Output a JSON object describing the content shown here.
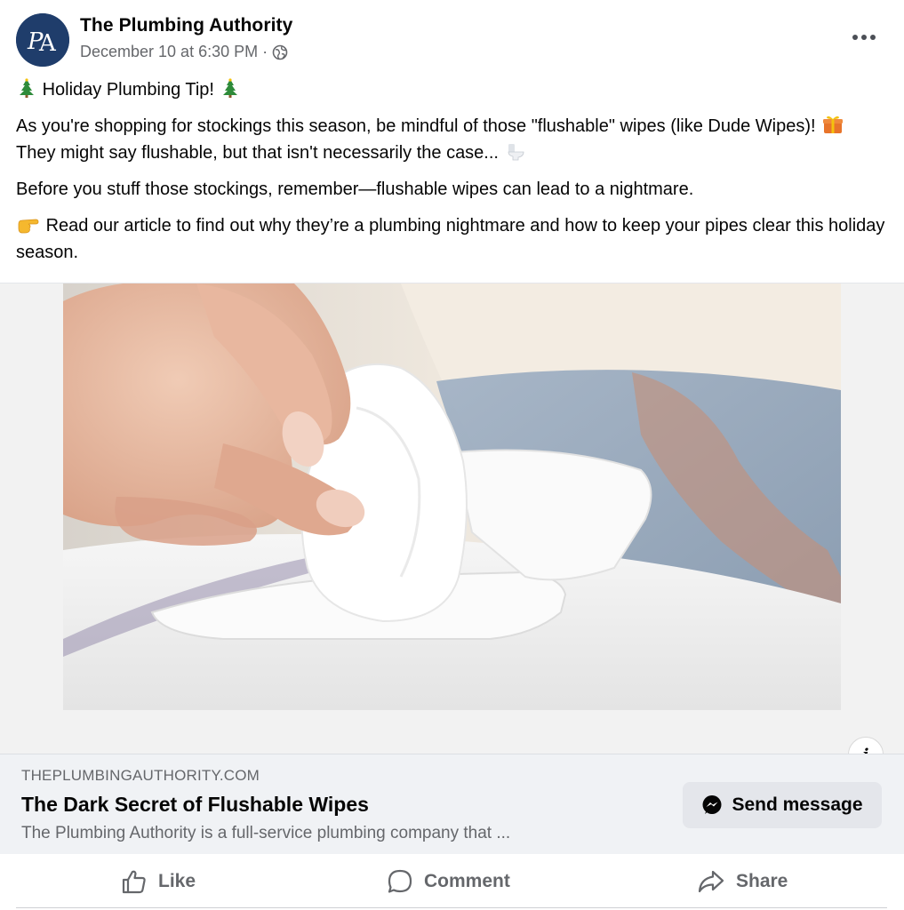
{
  "post": {
    "page_name": "The Plumbing Authority",
    "avatar_initials": "PA",
    "timestamp": "December 10 at 6:30 PM",
    "separator": "·",
    "privacy_icon": "globe-icon",
    "more_icon": "more-options-icon",
    "text": {
      "line1": "Holiday Plumbing Tip!",
      "para2_a": "As you're shopping for stockings this season, be mindful of those \"flushable\" wipes (like Dude Wipes)!",
      "para2_b": "They might say flushable, but that isn't necessarily the case...",
      "para3": "Before you stuff those stockings, remember—flushable wipes can lead to a nightmare.",
      "para4": "Read our article to find out why they’re a plumbing nightmare and how to keep your pipes clear this holiday season."
    }
  },
  "link_preview": {
    "domain": "THEPLUMBINGAUTHORITY.COM",
    "title": "The Dark Secret of Flushable Wipes",
    "description": "The Plumbing Authority is a full-service plumbing company that ...",
    "send_button": "Send message",
    "info_label": "i"
  },
  "actions": {
    "like": "Like",
    "comment": "Comment",
    "share": "Share"
  },
  "colors": {
    "brand_navy": "#1f3d6b",
    "secondary_text": "#65676b",
    "preview_bg": "#f0f2f5",
    "button_bg": "#e4e6eb"
  }
}
